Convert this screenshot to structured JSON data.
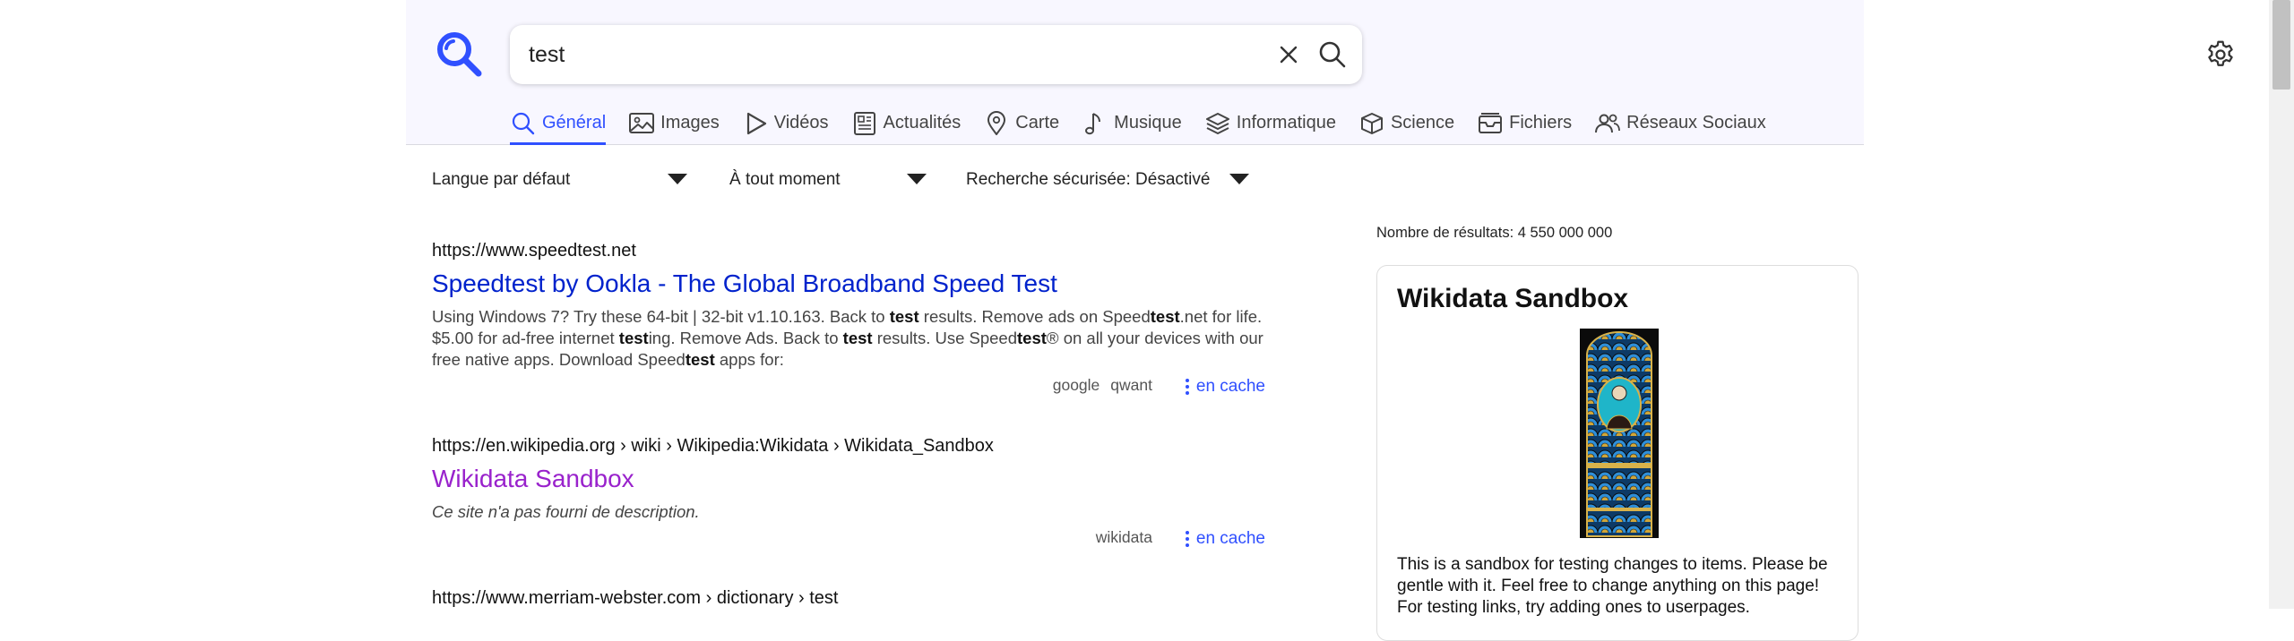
{
  "search": {
    "query": "test"
  },
  "tabs": [
    {
      "label": "Général",
      "icon": "search-icon",
      "active": true
    },
    {
      "label": "Images",
      "icon": "image-icon"
    },
    {
      "label": "Vidéos",
      "icon": "play-icon"
    },
    {
      "label": "Actualités",
      "icon": "newspaper-icon"
    },
    {
      "label": "Carte",
      "icon": "map-pin-icon"
    },
    {
      "label": "Musique",
      "icon": "music-icon"
    },
    {
      "label": "Informatique",
      "icon": "layers-icon"
    },
    {
      "label": "Science",
      "icon": "cube-icon"
    },
    {
      "label": "Fichiers",
      "icon": "archive-icon"
    },
    {
      "label": "Réseaux Sociaux",
      "icon": "people-icon"
    }
  ],
  "filters": {
    "language": "Langue par défaut",
    "time": "À tout moment",
    "safesearch": "Recherche sécurisée: Désactivé"
  },
  "results": [
    {
      "url": "https://www.speedtest.net",
      "title": "Speedtest by Ookla - The Global Broadband Speed Test",
      "snippet": [
        "Using Windows 7? Try these 64-bit | 32-bit v1.10.163. Back to ",
        "test",
        " results. Remove ads on Speed",
        "test",
        ".net for life. $5.00 for ad-free internet ",
        "test",
        "ing. Remove Ads. Back to ",
        "test",
        " results. Use Speed",
        "test",
        "® on all your devices with our free native apps. Download Speed",
        "test",
        " apps for:"
      ],
      "engines": [
        "google",
        "qwant"
      ],
      "cache": "en cache"
    },
    {
      "url": "https://en.wikipedia.org  › wiki › Wikipedia:Wikidata › Wikidata_Sandbox",
      "title": "Wikidata Sandbox",
      "snippet": "Ce site n'a pas fourni de description.",
      "engines": [
        "wikidata"
      ],
      "cache": "en cache"
    },
    {
      "url": "https://www.merriam-webster.com  › dictionary › test"
    }
  ],
  "result_count": "Nombre de résultats: 4 550 000 000",
  "infobox": {
    "title": "Wikidata Sandbox",
    "text": "This is a sandbox for testing changes to items. Please be gentle with it. Feel free to change anything on this page! For testing links, try adding ones to userpages."
  },
  "colors": {
    "accent": "#3050ff",
    "link": "#0022cc",
    "visited": "#9922cc",
    "header_bg": "#f8f7ff"
  }
}
